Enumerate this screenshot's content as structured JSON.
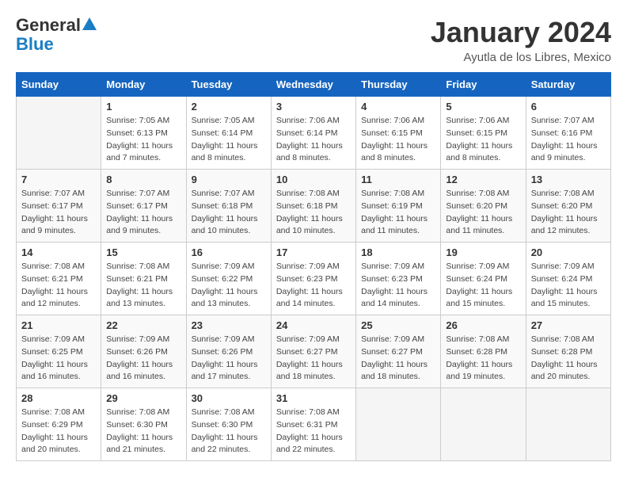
{
  "logo": {
    "line1": "General",
    "line2": "Blue"
  },
  "title": "January 2024",
  "location": "Ayutla de los Libres, Mexico",
  "days_of_week": [
    "Sunday",
    "Monday",
    "Tuesday",
    "Wednesday",
    "Thursday",
    "Friday",
    "Saturday"
  ],
  "weeks": [
    [
      {
        "day": "",
        "info": ""
      },
      {
        "day": "1",
        "info": "Sunrise: 7:05 AM\nSunset: 6:13 PM\nDaylight: 11 hours\nand 7 minutes."
      },
      {
        "day": "2",
        "info": "Sunrise: 7:05 AM\nSunset: 6:14 PM\nDaylight: 11 hours\nand 8 minutes."
      },
      {
        "day": "3",
        "info": "Sunrise: 7:06 AM\nSunset: 6:14 PM\nDaylight: 11 hours\nand 8 minutes."
      },
      {
        "day": "4",
        "info": "Sunrise: 7:06 AM\nSunset: 6:15 PM\nDaylight: 11 hours\nand 8 minutes."
      },
      {
        "day": "5",
        "info": "Sunrise: 7:06 AM\nSunset: 6:15 PM\nDaylight: 11 hours\nand 8 minutes."
      },
      {
        "day": "6",
        "info": "Sunrise: 7:07 AM\nSunset: 6:16 PM\nDaylight: 11 hours\nand 9 minutes."
      }
    ],
    [
      {
        "day": "7",
        "info": "Sunrise: 7:07 AM\nSunset: 6:17 PM\nDaylight: 11 hours\nand 9 minutes."
      },
      {
        "day": "8",
        "info": "Sunrise: 7:07 AM\nSunset: 6:17 PM\nDaylight: 11 hours\nand 9 minutes."
      },
      {
        "day": "9",
        "info": "Sunrise: 7:07 AM\nSunset: 6:18 PM\nDaylight: 11 hours\nand 10 minutes."
      },
      {
        "day": "10",
        "info": "Sunrise: 7:08 AM\nSunset: 6:18 PM\nDaylight: 11 hours\nand 10 minutes."
      },
      {
        "day": "11",
        "info": "Sunrise: 7:08 AM\nSunset: 6:19 PM\nDaylight: 11 hours\nand 11 minutes."
      },
      {
        "day": "12",
        "info": "Sunrise: 7:08 AM\nSunset: 6:20 PM\nDaylight: 11 hours\nand 11 minutes."
      },
      {
        "day": "13",
        "info": "Sunrise: 7:08 AM\nSunset: 6:20 PM\nDaylight: 11 hours\nand 12 minutes."
      }
    ],
    [
      {
        "day": "14",
        "info": "Sunrise: 7:08 AM\nSunset: 6:21 PM\nDaylight: 11 hours\nand 12 minutes."
      },
      {
        "day": "15",
        "info": "Sunrise: 7:08 AM\nSunset: 6:21 PM\nDaylight: 11 hours\nand 13 minutes."
      },
      {
        "day": "16",
        "info": "Sunrise: 7:09 AM\nSunset: 6:22 PM\nDaylight: 11 hours\nand 13 minutes."
      },
      {
        "day": "17",
        "info": "Sunrise: 7:09 AM\nSunset: 6:23 PM\nDaylight: 11 hours\nand 14 minutes."
      },
      {
        "day": "18",
        "info": "Sunrise: 7:09 AM\nSunset: 6:23 PM\nDaylight: 11 hours\nand 14 minutes."
      },
      {
        "day": "19",
        "info": "Sunrise: 7:09 AM\nSunset: 6:24 PM\nDaylight: 11 hours\nand 15 minutes."
      },
      {
        "day": "20",
        "info": "Sunrise: 7:09 AM\nSunset: 6:24 PM\nDaylight: 11 hours\nand 15 minutes."
      }
    ],
    [
      {
        "day": "21",
        "info": "Sunrise: 7:09 AM\nSunset: 6:25 PM\nDaylight: 11 hours\nand 16 minutes."
      },
      {
        "day": "22",
        "info": "Sunrise: 7:09 AM\nSunset: 6:26 PM\nDaylight: 11 hours\nand 16 minutes."
      },
      {
        "day": "23",
        "info": "Sunrise: 7:09 AM\nSunset: 6:26 PM\nDaylight: 11 hours\nand 17 minutes."
      },
      {
        "day": "24",
        "info": "Sunrise: 7:09 AM\nSunset: 6:27 PM\nDaylight: 11 hours\nand 18 minutes."
      },
      {
        "day": "25",
        "info": "Sunrise: 7:09 AM\nSunset: 6:27 PM\nDaylight: 11 hours\nand 18 minutes."
      },
      {
        "day": "26",
        "info": "Sunrise: 7:08 AM\nSunset: 6:28 PM\nDaylight: 11 hours\nand 19 minutes."
      },
      {
        "day": "27",
        "info": "Sunrise: 7:08 AM\nSunset: 6:28 PM\nDaylight: 11 hours\nand 20 minutes."
      }
    ],
    [
      {
        "day": "28",
        "info": "Sunrise: 7:08 AM\nSunset: 6:29 PM\nDaylight: 11 hours\nand 20 minutes."
      },
      {
        "day": "29",
        "info": "Sunrise: 7:08 AM\nSunset: 6:30 PM\nDaylight: 11 hours\nand 21 minutes."
      },
      {
        "day": "30",
        "info": "Sunrise: 7:08 AM\nSunset: 6:30 PM\nDaylight: 11 hours\nand 22 minutes."
      },
      {
        "day": "31",
        "info": "Sunrise: 7:08 AM\nSunset: 6:31 PM\nDaylight: 11 hours\nand 22 minutes."
      },
      {
        "day": "",
        "info": ""
      },
      {
        "day": "",
        "info": ""
      },
      {
        "day": "",
        "info": ""
      }
    ]
  ]
}
